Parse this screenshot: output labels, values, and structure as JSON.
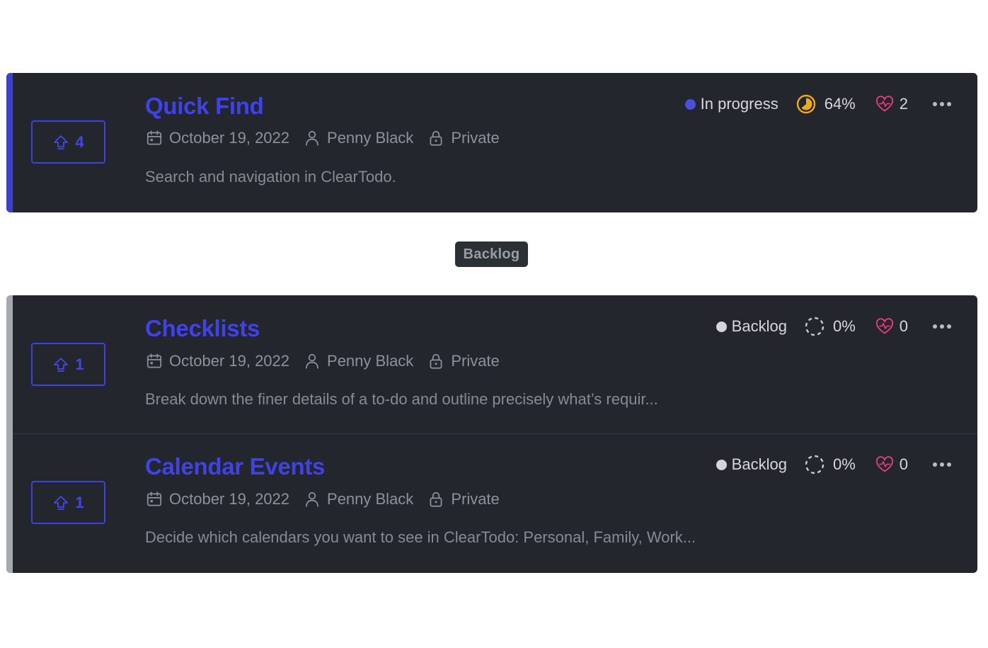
{
  "groups": {
    "backlog_label": "Backlog"
  },
  "colors": {
    "accent": "#3b3fd6",
    "in_progress_dot": "#4b4fdc",
    "backlog_dot": "#d4d6da",
    "progress_partial": "#f0a81c",
    "heart": "#e8407a",
    "card_bg": "#23262d"
  },
  "items": [
    {
      "votes": "4",
      "title": "Quick Find",
      "date": "October 19, 2022",
      "owner": "Penny Black",
      "visibility": "Private",
      "description": "Search and navigation in ClearTodo.",
      "status": "In progress",
      "progress_label": "64%",
      "progress_value": 0.64,
      "likes": "2",
      "icons": [
        "upvote-arrow-icon",
        "calendar-icon",
        "person-icon",
        "lock-icon",
        "status-dot-icon",
        "progress-pie-icon",
        "heart-pulse-icon",
        "more-dots-icon"
      ]
    },
    {
      "votes": "1",
      "title": "Checklists",
      "date": "October 19, 2022",
      "owner": "Penny Black",
      "visibility": "Private",
      "description": "Break down the finer details of a to-do and outline precisely what’s requir...",
      "status": "Backlog",
      "progress_label": "0%",
      "progress_value": 0,
      "likes": "0",
      "icons": [
        "upvote-arrow-icon",
        "calendar-icon",
        "person-icon",
        "lock-icon",
        "status-dot-icon",
        "progress-dashed-icon",
        "heart-pulse-icon",
        "more-dots-icon"
      ]
    },
    {
      "votes": "1",
      "title": "Calendar Events",
      "date": "October 19, 2022",
      "owner": "Penny Black",
      "visibility": "Private",
      "description": "Decide which calendars you want to see in ClearTodo: Personal, Family, Work...",
      "status": "Backlog",
      "progress_label": "0%",
      "progress_value": 0,
      "likes": "0",
      "icons": [
        "upvote-arrow-icon",
        "calendar-icon",
        "person-icon",
        "lock-icon",
        "status-dot-icon",
        "progress-dashed-icon",
        "heart-pulse-icon",
        "more-dots-icon"
      ]
    }
  ]
}
